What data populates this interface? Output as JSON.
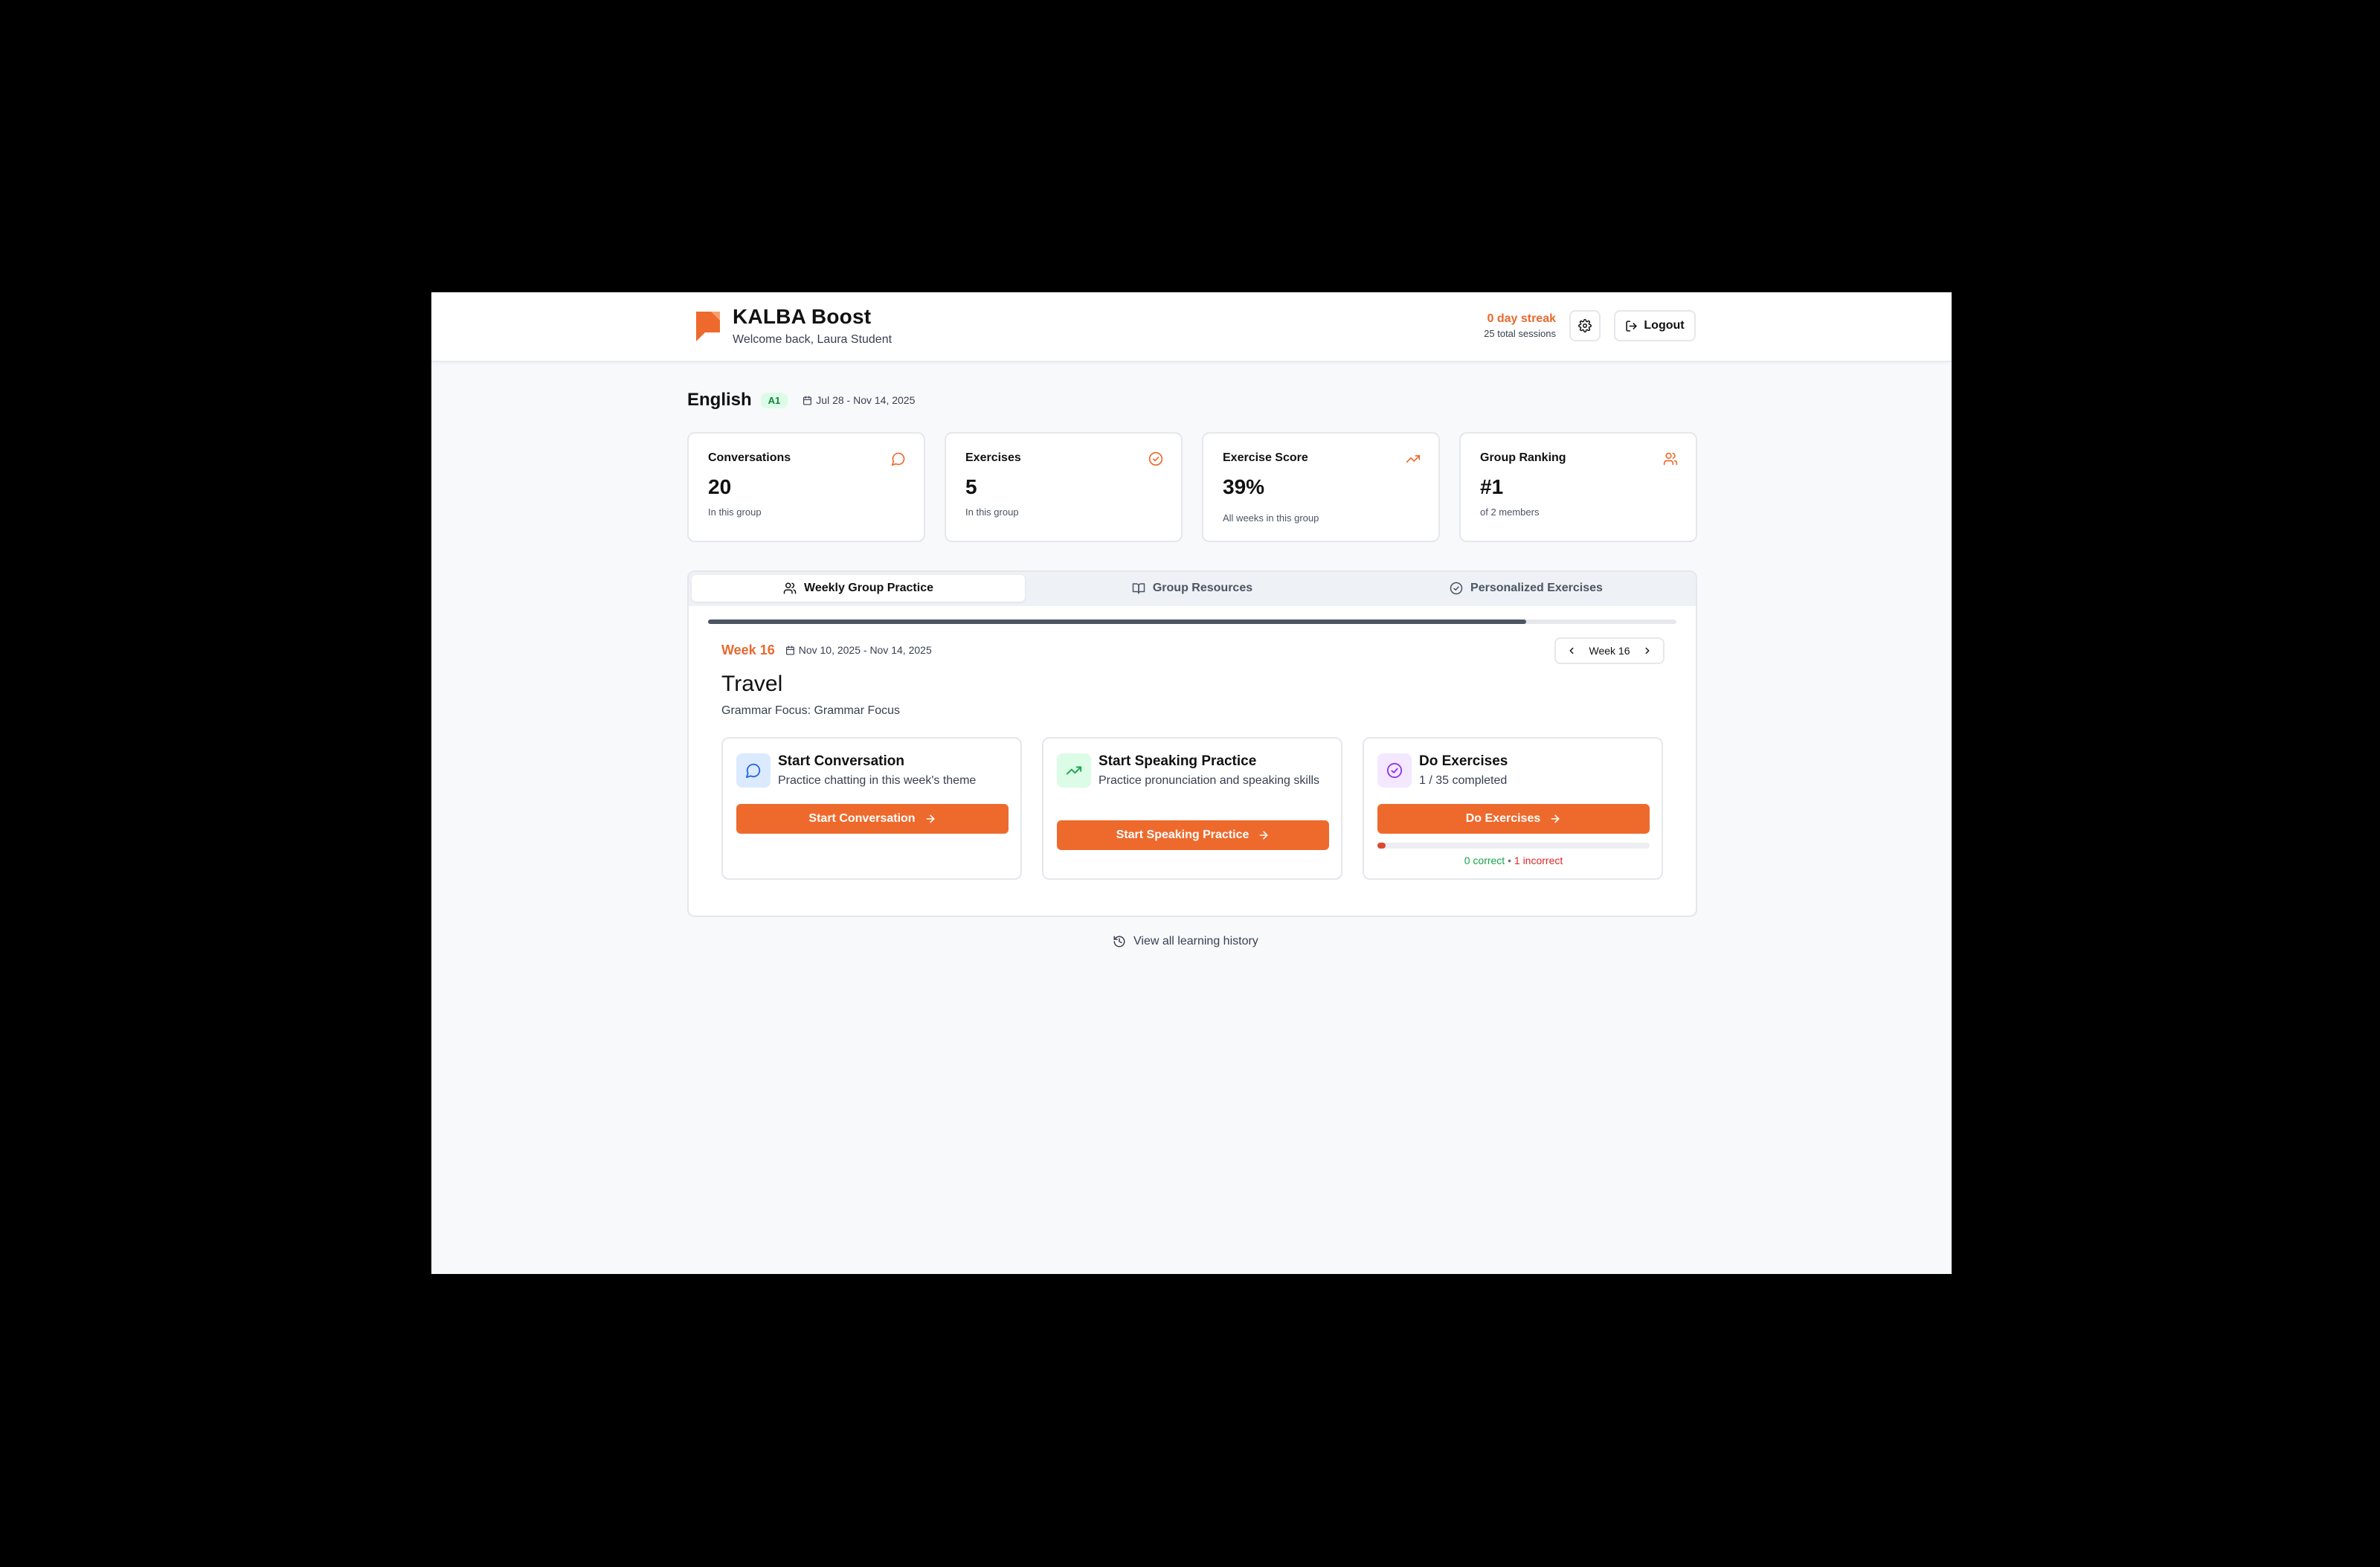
{
  "header": {
    "brand": "KALBA Boost",
    "welcome": "Welcome back, Laura Student",
    "streak": "0 day streak",
    "sessions": "25 total sessions",
    "logout_label": "Logout"
  },
  "course": {
    "language": "English",
    "level": "A1",
    "dates": "Jul 28 - Nov 14, 2025"
  },
  "stats": [
    {
      "label": "Conversations",
      "value": "20",
      "sub": "In this group",
      "icon": "message-icon"
    },
    {
      "label": "Exercises",
      "value": "5",
      "sub": "In this group",
      "icon": "check-circle-icon"
    },
    {
      "label": "Exercise Score",
      "value": "39%",
      "sub": "All weeks in this group",
      "icon": "trending-up-icon"
    },
    {
      "label": "Group Ranking",
      "value": "#1",
      "sub": "of 2 members",
      "icon": "users-icon"
    }
  ],
  "tabs": [
    {
      "label": "Weekly Group Practice",
      "icon": "users-icon",
      "active": true
    },
    {
      "label": "Group Resources",
      "icon": "book-open-icon",
      "active": false
    },
    {
      "label": "Personalized Exercises",
      "icon": "check-circle-icon",
      "active": false
    }
  ],
  "week": {
    "label": "Week 16",
    "dates": "Nov 10, 2025 - Nov 14, 2025",
    "nav_label": "Week 16",
    "progress": 0.845,
    "theme": "Travel",
    "grammar": "Grammar Focus: Grammar Focus"
  },
  "actions": [
    {
      "title": "Start Conversation",
      "desc": "Practice chatting in this week's theme",
      "button": "Start Conversation",
      "icon": "message-icon"
    },
    {
      "title": "Start Speaking Practice",
      "desc": "Practice pronunciation and speaking skills",
      "button": "Start Speaking Practice",
      "icon": "trending-up-icon"
    },
    {
      "title": "Do Exercises",
      "desc": "1 / 35 completed",
      "button": "Do Exercises",
      "icon": "check-circle-icon",
      "completed": 1,
      "total": 35,
      "correct_text": "0 correct",
      "separator": "•",
      "incorrect_text": "1 incorrect"
    }
  ],
  "colors": {
    "accent": "#ee6a2c",
    "correct": "#16a34a",
    "incorrect": "#dc2626"
  },
  "history_link": "View all learning history"
}
